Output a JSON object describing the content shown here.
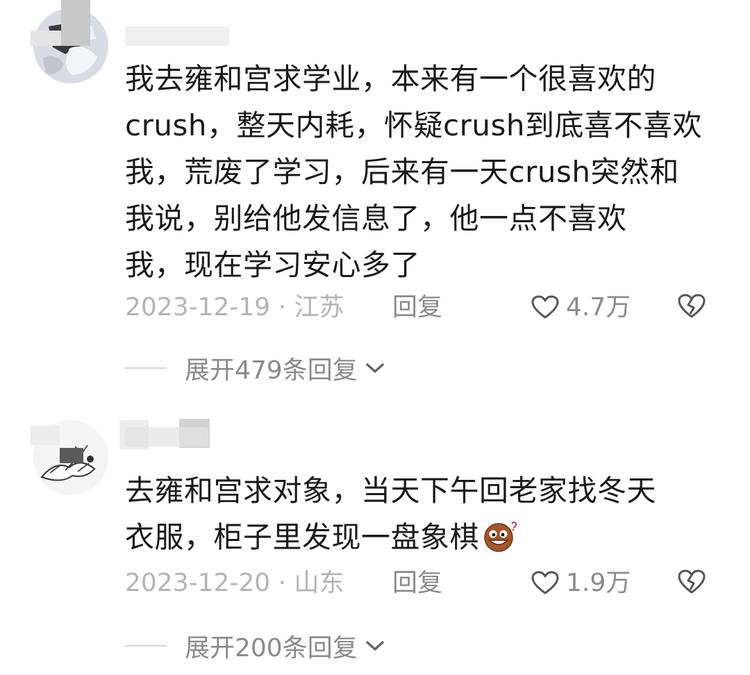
{
  "comments": [
    {
      "text": "我去雍和宫求学业，本来有一个很喜欢的\ncrush，整天内耗，怀疑crush到底喜不喜欢\n我，荒废了学习，后来有一天crush突然和\n我说，别给他发信息了，他一点不喜欢\n我，现在学习安心多了",
      "date_location": "2023-12-19 · 江苏",
      "reply_label": "回复",
      "likes": "4.7万",
      "expand_label": "展开479条回复"
    },
    {
      "text": "去雍和宫求对象，当天下午回老家找冬天\n衣服，柜子里发现一盘象棋",
      "date_location": "2023-12-20 · 山东",
      "reply_label": "回复",
      "likes": "1.9万",
      "expand_label": "展开200条回复"
    }
  ],
  "icons": {
    "like": "heart-outline-icon",
    "dislike": "broken-heart-icon",
    "expand": "chevron-down-icon",
    "emoji": "grinning-face-emoji"
  },
  "colors": {
    "text": "#1a1a1a",
    "meta_light": "#b3b3b3",
    "meta_dark": "#8a8a8a"
  }
}
